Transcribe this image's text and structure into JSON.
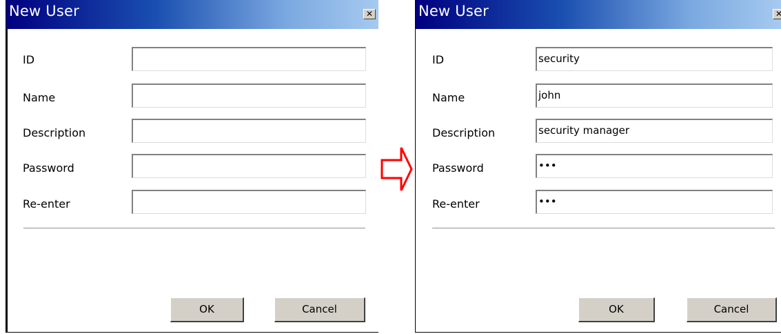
{
  "left_dialog": {
    "title": "New User",
    "close_glyph": "✕",
    "fields": [
      {
        "label": "ID",
        "value": ""
      },
      {
        "label": "Name",
        "value": ""
      },
      {
        "label": "Description",
        "value": ""
      },
      {
        "label": "Password",
        "value": ""
      },
      {
        "label": "Re-enter",
        "value": ""
      }
    ],
    "ok_label": "OK",
    "cancel_label": "Cancel"
  },
  "right_dialog": {
    "title": "New User",
    "close_glyph": "✕",
    "fields": [
      {
        "label": "ID",
        "value": "security"
      },
      {
        "label": "Name",
        "value": "john"
      },
      {
        "label": "Description",
        "value": "security manager"
      },
      {
        "label": "Password",
        "value": "•••"
      },
      {
        "label": "Re-enter",
        "value": "•••"
      }
    ],
    "ok_label": "OK",
    "cancel_label": "Cancel"
  },
  "arrow": {
    "icon": "right-arrow-icon",
    "color": "#ff0000"
  },
  "colors": {
    "titlebar_start": "#000080",
    "titlebar_end": "#a6caf0",
    "button_face": "#d4d0c8"
  }
}
